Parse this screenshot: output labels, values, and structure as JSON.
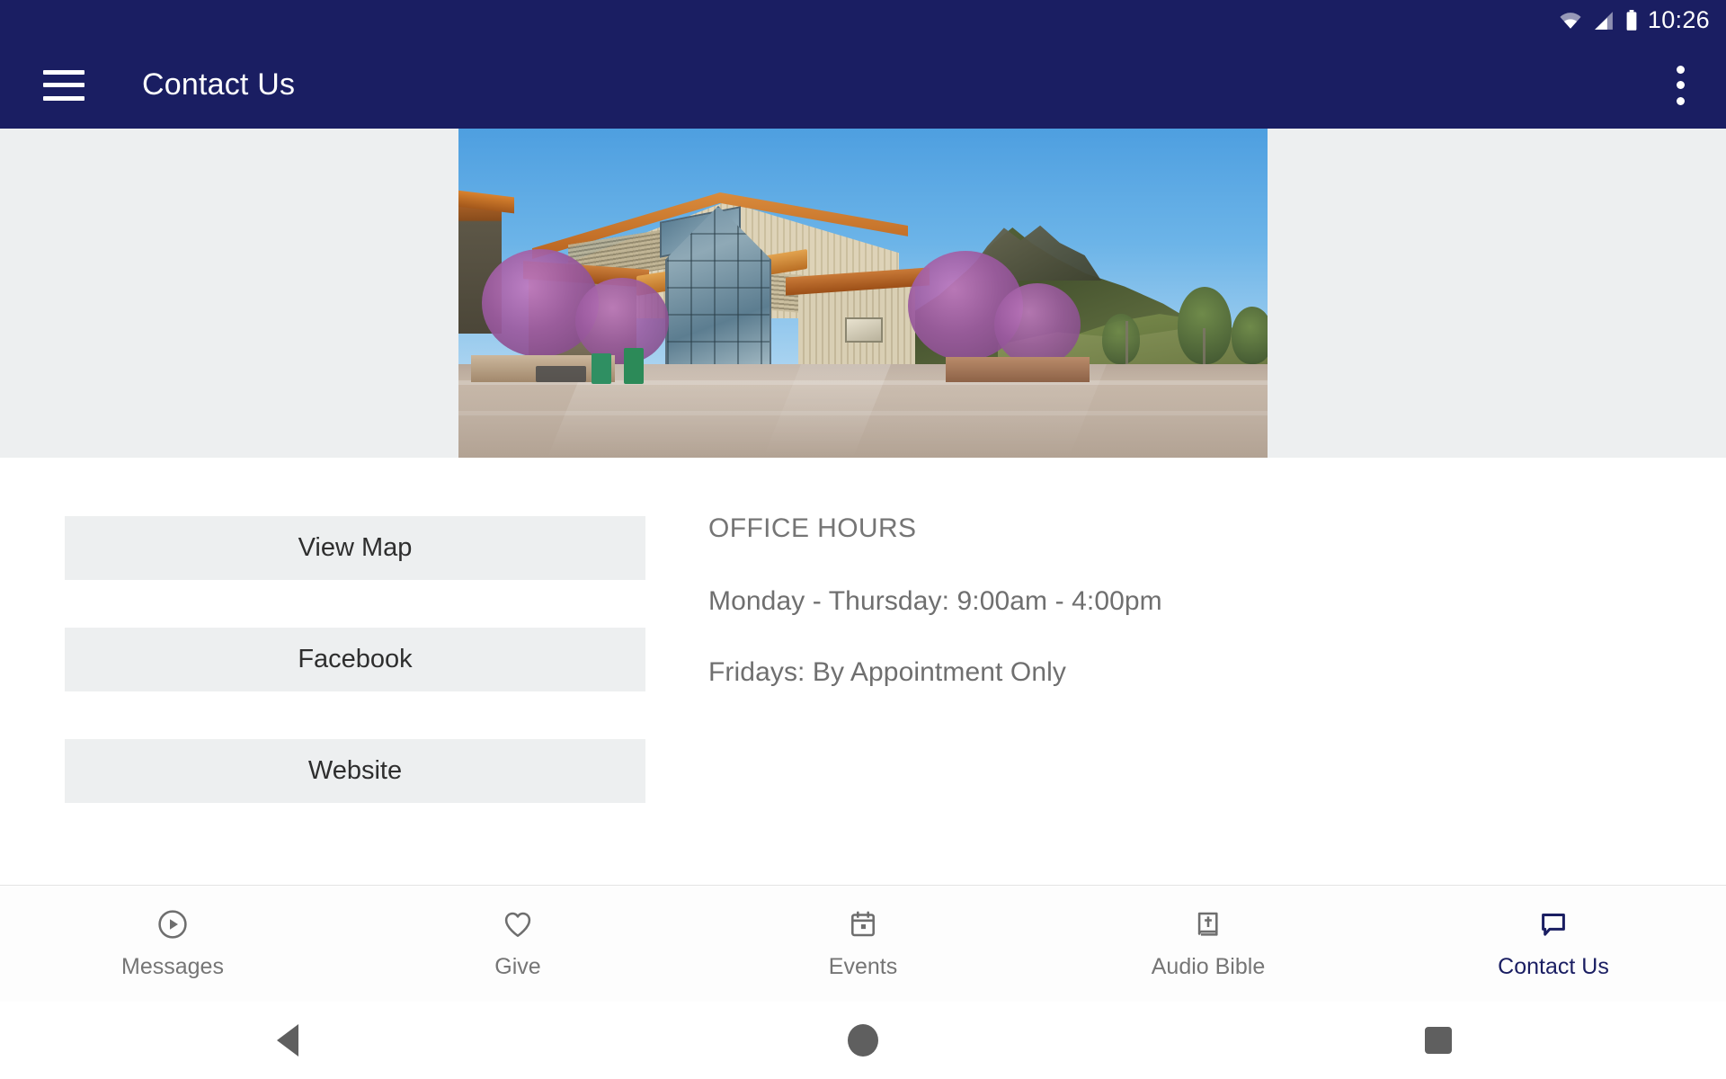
{
  "statusbar": {
    "time": "10:26",
    "icons": [
      "wifi-icon",
      "cellular-signal-icon",
      "battery-icon"
    ]
  },
  "appbar": {
    "menu_icon": "hamburger-menu-icon",
    "title": "Contact Us",
    "overflow_icon": "more-vertical-icon"
  },
  "hero": {
    "alt": "church-building-photo"
  },
  "main": {
    "buttons": [
      {
        "label": "View Map",
        "name": "view-map-button"
      },
      {
        "label": "Facebook",
        "name": "facebook-button"
      },
      {
        "label": "Website",
        "name": "website-button"
      }
    ],
    "hours": {
      "title": "OFFICE HOURS",
      "lines": [
        "Monday - Thursday: 9:00am - 4:00pm",
        "Fridays: By Appointment Only"
      ]
    }
  },
  "tabbar": {
    "active_index": 4,
    "active_color": "#1a1e62",
    "inactive_color": "#757575",
    "tabs": [
      {
        "label": "Messages",
        "icon": "play-circle-icon"
      },
      {
        "label": "Give",
        "icon": "heart-icon"
      },
      {
        "label": "Events",
        "icon": "calendar-icon"
      },
      {
        "label": "Audio Bible",
        "icon": "bible-book-icon"
      },
      {
        "label": "Contact Us",
        "icon": "chat-bubble-icon"
      }
    ]
  },
  "sysnav": {
    "back": "back-triangle-icon",
    "home": "home-circle-icon",
    "recent": "recent-apps-square-icon"
  },
  "colors": {
    "brand_navy": "#1a1e62",
    "surface_gray": "#edeff0",
    "text_gray": "#6f6f6f"
  }
}
